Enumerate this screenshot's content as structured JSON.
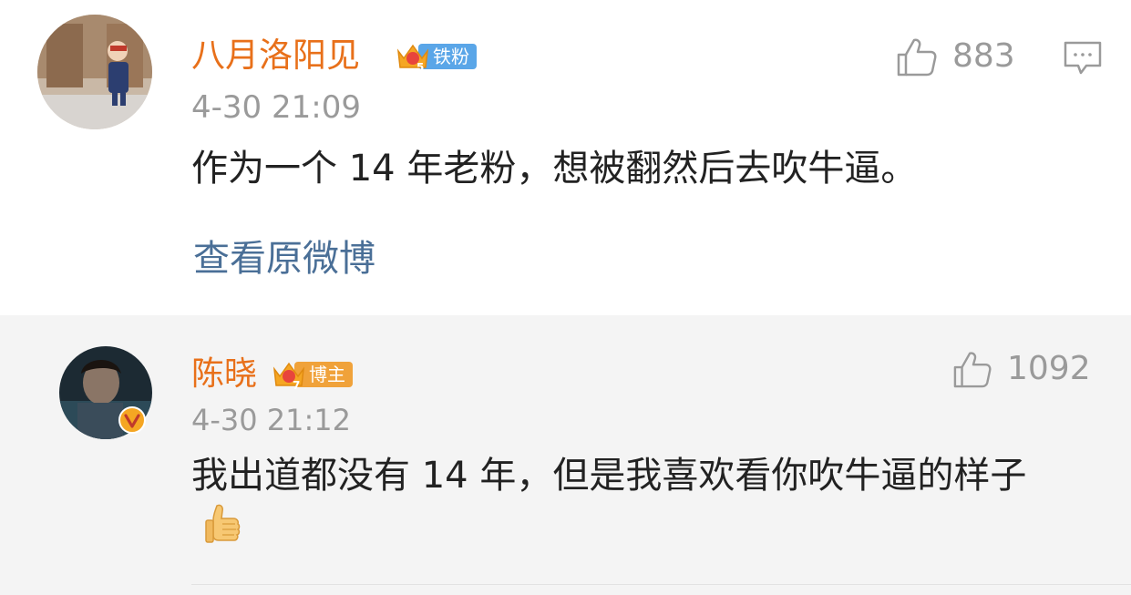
{
  "comments": [
    {
      "username": "八月洛阳见",
      "badge_level": "5",
      "badge_label": "铁粉",
      "time": "4-30 21:09",
      "text": "作为一个 14 年老粉，想被翻然后去吹牛逼。",
      "likes": "883",
      "view_original": "查看原微博",
      "avatar_icon": "user-avatar-photo",
      "colors": {
        "name": "#e8701a",
        "badge": "#5aa6e8"
      }
    },
    {
      "username": "陈晓",
      "badge_level": "7",
      "badge_label": "博主",
      "time": "4-30 21:12",
      "text": "我出道都没有 14 年，但是我喜欢看你吹牛逼的样子",
      "emoji": "thumbs-up",
      "likes": "1092",
      "avatar_icon": "verified-user-avatar",
      "colors": {
        "name": "#e8701a",
        "badge": "#f0a23a",
        "verified": "#f5a623"
      }
    }
  ]
}
